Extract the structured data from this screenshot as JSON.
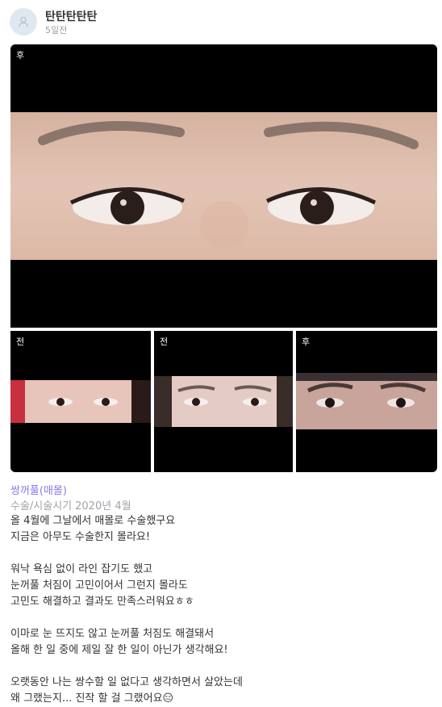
{
  "post": {
    "author": "탄탄탄탄탄",
    "time_ago": "5일전",
    "category": "쌍꺼풀(매몰)",
    "period_label": "수술/시술시기",
    "period_value": "2020년 4월",
    "lines": [
      "올 4월에 그날에서 매몰로 수술했구요",
      "지금은 아무도 수술한지 몰라요!",
      "",
      "워낙 욕심 없이 라인 잡기도 했고",
      "눈꺼풀 처짐이 고민이어서 그런지 몰라도",
      "고민도 해결하고 결과도 만족스러워요ㅎㅎ",
      "",
      "이마로 눈 뜨지도 않고 눈꺼풀 처짐도 해결돼서",
      "올해 한 일 중에 제일 잘 한 일이 아닌가 생각해요!",
      "",
      "오랫동안 나는 쌍수할 일 없다고 생각하면서 살았는데",
      "왜 그랬는지... 진작 할 걸 그랬어요😑"
    ]
  },
  "photos": {
    "main_tag": "후",
    "small1_tag": "전",
    "small2_tag": "전",
    "small3_tag": "후"
  },
  "icons": {
    "avatar": "user-icon"
  }
}
